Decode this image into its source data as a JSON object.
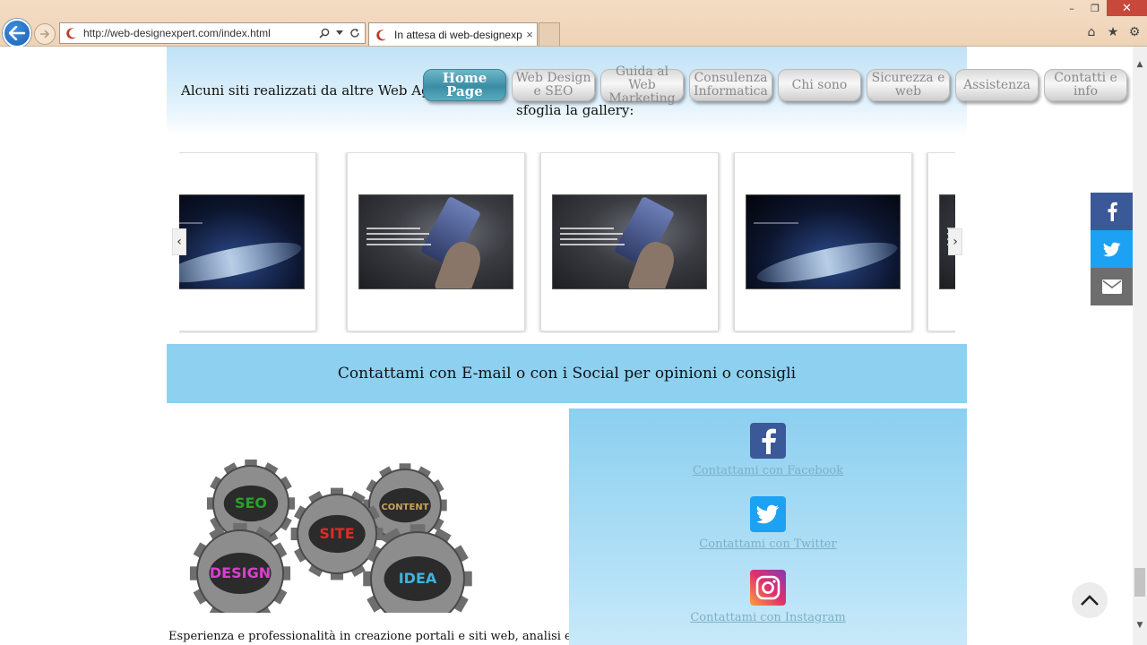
{
  "browser": {
    "url": "http://web-designexpert.com/index.html",
    "tab_title": "In attesa di web-designexpe...",
    "tab_close": "×",
    "window_controls": {
      "minimize": "–",
      "restore": "❐",
      "close": "✕"
    },
    "icons": [
      "back-arrow-icon",
      "forward-arrow-icon",
      "search-icon",
      "dropdown-icon",
      "refresh-icon",
      "home-icon",
      "star-icon",
      "gear-icon"
    ]
  },
  "hero": {
    "intro_text": "Alcuni siti realizzati da altre Web Agency",
    "gallery_hint": "sfoglia la gallery:"
  },
  "nav": {
    "items": [
      {
        "label": "Home Page",
        "active": true
      },
      {
        "label": "Web Design e SEO",
        "active": false
      },
      {
        "label": "Guida al Web Marketing",
        "active": false
      },
      {
        "label": "Consulenza Informatica",
        "active": false
      },
      {
        "label": "Chi sono",
        "active": false
      },
      {
        "label": "Sicurezza e web",
        "active": false
      },
      {
        "label": "Assistenza",
        "active": false
      },
      {
        "label": "Contatti e info",
        "active": false
      }
    ]
  },
  "gallery": {
    "prev_label": "‹",
    "next_label": "›",
    "cards": [
      "blue",
      "dark",
      "dark",
      "blue",
      "dark"
    ]
  },
  "contact_bar": {
    "title": "Contattami con E-mail o con i Social per opinioni o consigli"
  },
  "gears_image": {
    "labels": [
      "SEO",
      "CONTENT",
      "SITE",
      "DESIGN",
      "IDEA"
    ]
  },
  "experience_text": "Esperienza e professionalità in creazione portali e siti web, analisi e strategie",
  "social_links": {
    "facebook": "Contattami con Facebook",
    "twitter": "Contattami con Twitter",
    "instagram": "Contattami con Instagram"
  },
  "colors": {
    "facebook": "#3b5998",
    "twitter": "#1da1f2",
    "email": "#6d6d6d",
    "contact_bar": "#8ed0f0",
    "nav_active": "#3a8da4"
  }
}
